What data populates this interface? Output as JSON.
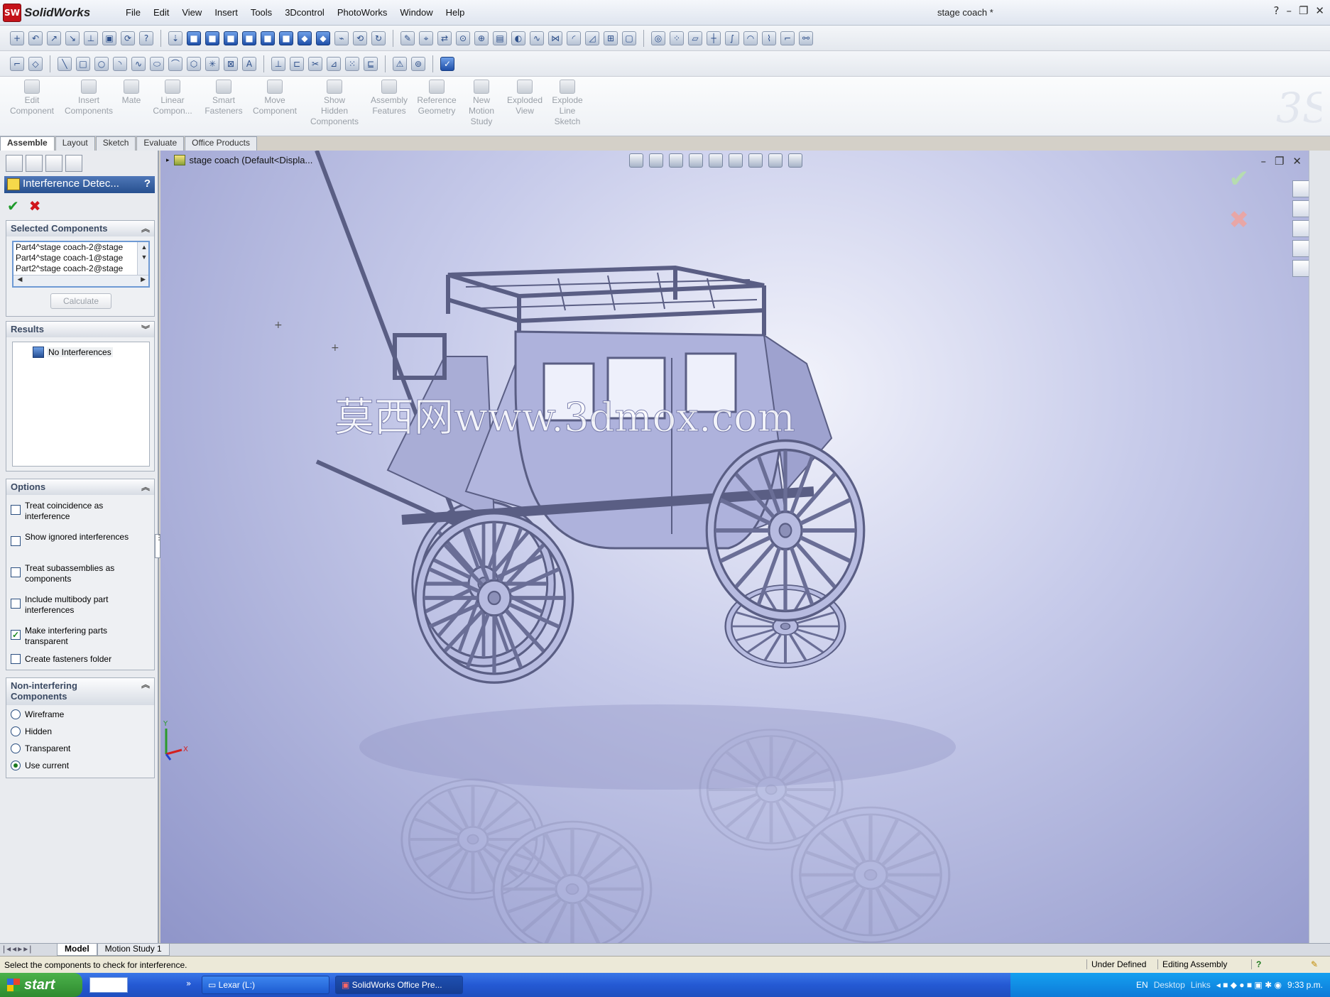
{
  "app": {
    "name": "SolidWorks",
    "badge": "SW",
    "doc_title": "stage coach *"
  },
  "menu": [
    "File",
    "Edit",
    "View",
    "Insert",
    "Tools",
    "3Dcontrol",
    "PhotoWorks",
    "Window",
    "Help"
  ],
  "window_controls": {
    "help": "?",
    "minimize": "–",
    "restore": "❐",
    "close": "✕"
  },
  "command_manager": [
    {
      "label": "Edit\nComponent"
    },
    {
      "label": "Insert\nComponents"
    },
    {
      "label": "Mate"
    },
    {
      "label": "Linear\nCompon..."
    },
    {
      "label": "Smart\nFasteners"
    },
    {
      "label": "Move\nComponent"
    },
    {
      "label": "Show\nHidden\nComponents"
    },
    {
      "label": "Assembly\nFeatures"
    },
    {
      "label": "Reference\nGeometry"
    },
    {
      "label": "New\nMotion\nStudy"
    },
    {
      "label": "Exploded\nView"
    },
    {
      "label": "Explode\nLine\nSketch"
    }
  ],
  "tabs": [
    "Assemble",
    "Layout",
    "Sketch",
    "Evaluate",
    "Office Products"
  ],
  "property_manager": {
    "title": "Interference Detec...",
    "help": "?",
    "ok": "✔",
    "cancel": "✖",
    "selected_components": {
      "header": "Selected Components",
      "items": [
        "Part4^stage coach-2@stage",
        "Part4^stage coach-1@stage",
        "Part2^stage coach-2@stage"
      ],
      "calculate": "Calculate"
    },
    "results": {
      "header": "Results",
      "items": [
        "No Interferences"
      ]
    },
    "options": {
      "header": "Options",
      "items": [
        {
          "label": "Treat coincidence as interference",
          "checked": false
        },
        {
          "label": "Show ignored interferences",
          "checked": false
        },
        {
          "label": "Treat subassemblies as components",
          "checked": false
        },
        {
          "label": "Include multibody part interferences",
          "checked": false
        },
        {
          "label": "Make interfering parts transparent",
          "checked": true
        },
        {
          "label": "Create fasteners folder",
          "checked": false
        }
      ]
    },
    "non_interfering": {
      "header": "Non-interfering Components",
      "items": [
        {
          "label": "Wireframe",
          "selected": false
        },
        {
          "label": "Hidden",
          "selected": false
        },
        {
          "label": "Transparent",
          "selected": false
        },
        {
          "label": "Use current",
          "selected": true
        }
      ]
    }
  },
  "viewport": {
    "tree_root": "stage coach  (Default<Displa...",
    "watermark": "莫西网www.3dmox.com",
    "confirm_ok": "✔",
    "confirm_cancel": "✖",
    "triad": {
      "y": "Y",
      "x": "X"
    }
  },
  "bottom_tabs": [
    "Model",
    "Motion Study 1"
  ],
  "status": {
    "message": "Select the components to check for interference.",
    "state": "Under Defined",
    "mode": "Editing Assembly",
    "help": "?"
  },
  "taskbar": {
    "start": "start",
    "items": [
      "Lexar (L:)",
      "SolidWorks Office Pre..."
    ],
    "lang": "EN",
    "desktop": "Desktop",
    "links": "Links",
    "clock": "9:33 p.m."
  },
  "colors": {
    "accent": "#27508f",
    "ok": "#1e9a2a",
    "cancel": "#d0161c",
    "model": "#a9add6",
    "taskbar": "#2459d3"
  }
}
